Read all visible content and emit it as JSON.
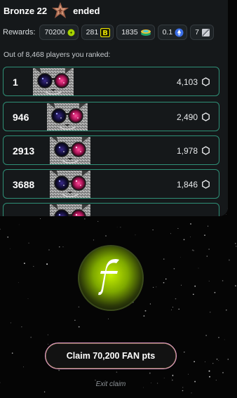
{
  "header": {
    "league": "Bronze 22",
    "status": "ended"
  },
  "rewards": {
    "label": "Rewards:",
    "chips": [
      {
        "value": "70200",
        "icon": "fan-icon"
      },
      {
        "value": "281",
        "icon": "b-token-icon"
      },
      {
        "value": "1835",
        "icon": "coin-stack-icon"
      },
      {
        "value": "0.1",
        "icon": "eth-icon"
      },
      {
        "value": "7",
        "icon": "card-icon"
      }
    ]
  },
  "ranking": {
    "summary": "Out of 8,468 players you ranked:",
    "rows": [
      {
        "rank": "1",
        "score": "4,103"
      },
      {
        "rank": "946",
        "score": "2,490"
      },
      {
        "rank": "2913",
        "score": "1,978"
      },
      {
        "rank": "3688",
        "score": "1,846"
      }
    ]
  },
  "claim": {
    "button_label": "Claim 70,200 FAN pts",
    "exit_label": "Exit claim"
  },
  "colors": {
    "row_border": "#2f8f76",
    "panel_bg": "#15181a",
    "coin_glow": "#b7f000"
  }
}
